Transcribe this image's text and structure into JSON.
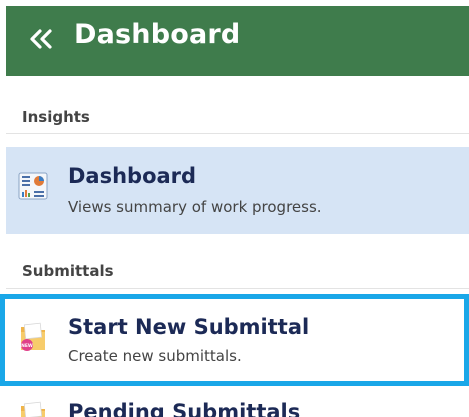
{
  "header": {
    "title": "Dashboard",
    "collapse_icon": "double-chevron-left-icon"
  },
  "sections": {
    "insights": "Insights",
    "submittals": "Submittals"
  },
  "items": [
    {
      "title": "Dashboard",
      "description": "Views summary of work progress.",
      "icon": "dashboard-chart-icon",
      "active": true
    },
    {
      "title": "Start New Submittal",
      "description": "Create new submittals.",
      "icon": "new-folder-icon",
      "highlighted": true
    },
    {
      "title": "Pending Submittals",
      "icon": "folder-icon"
    }
  ],
  "colors": {
    "header_bg": "#3f7c4c",
    "active_bg": "#d6e4f5",
    "highlight_border": "#1aa7e8",
    "title_text": "#1c2a56"
  }
}
